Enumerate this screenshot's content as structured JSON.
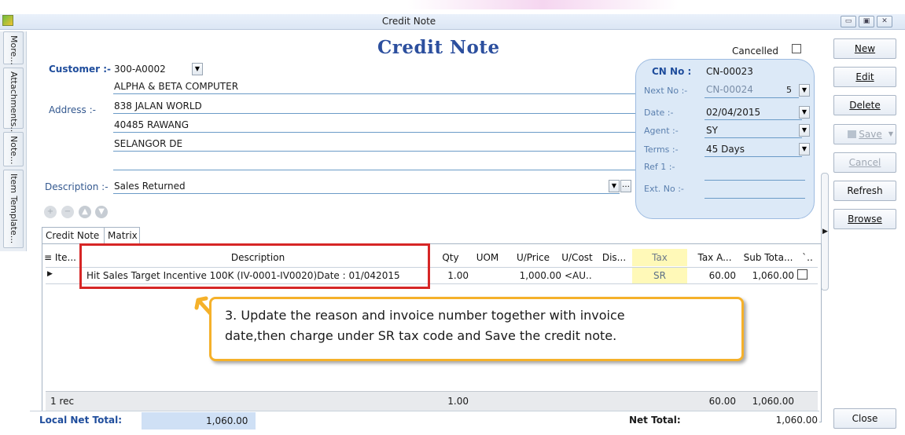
{
  "window": {
    "title": "Credit Note",
    "controls": [
      "minimize",
      "restore",
      "close"
    ]
  },
  "left_tabs": [
    "More...",
    "Attachments...",
    "Note...",
    "Item Template..."
  ],
  "heading": "Credit Note",
  "customer": {
    "label": "Customer :-",
    "code": "300-A0002",
    "name": "ALPHA & BETA COMPUTER",
    "address_label": "Address :-",
    "address_lines": [
      "838 JALAN WORLD",
      "40485 RAWANG",
      "SELANGOR DE",
      ""
    ]
  },
  "description": {
    "label": "Description :-",
    "value": "Sales Returned"
  },
  "cancelled": {
    "label": "Cancelled",
    "checked": false
  },
  "cn_panel": {
    "cn_no_label": "CN No :",
    "cn_no": "CN-00023",
    "next_no_label": "Next No :-",
    "next_no": "CN-00024",
    "next_no_suffix": "5",
    "date_label": "Date :-",
    "date": "02/04/2015",
    "agent_label": "Agent :-",
    "agent": "SY",
    "terms_label": "Terms :-",
    "terms": "45 Days",
    "ref1_label": "Ref 1 :-",
    "ref1": "",
    "ext_no_label": "Ext. No :-",
    "ext_no": ""
  },
  "right_buttons": {
    "new": "New",
    "edit": "Edit",
    "delete": "Delete",
    "save": "Save",
    "cancel": "Cancel",
    "refresh": "Refresh",
    "browse": "Browse",
    "close": "Close"
  },
  "tabs": [
    "Credit Note",
    "Matrix"
  ],
  "grid": {
    "columns": [
      "Ite...",
      "Description",
      "Qty",
      "UOM",
      "U/Price",
      "U/Cost",
      "Dis...",
      "Tax",
      "Tax A...",
      "Sub Tota...",
      "`.."
    ],
    "rows": [
      {
        "item": "",
        "description": "Hit Sales Target Incentive 100K (IV-0001-IV0020)Date : 01/042015",
        "qty": "1.00",
        "uom": "",
        "uprice": "1,000.00",
        "ucost": "<AU..",
        "disc": "",
        "tax": "SR",
        "tax_amount": "60.00",
        "subtotal": "1,060.00"
      }
    ],
    "footer": {
      "records": "1 rec",
      "qty_total": "1.00",
      "tax_total": "60.00",
      "sub_total": "1,060.00"
    }
  },
  "callout": {
    "line1": "3. Update the reason and invoice number together with invoice",
    "line2": "date,then charge under SR tax code and Save the credit note."
  },
  "totals": {
    "local_net_total_label": "Local Net Total:",
    "local_net_total": "1,060.00",
    "net_total_label": "Net Total:",
    "net_total": "1,060.00"
  },
  "colors": {
    "heading": "#2c4f9e",
    "panel_bg": "#dce9f7",
    "tax_highlight": "#fff9b8",
    "annotation_red": "#d62626",
    "callout_orange": "#f5b12a"
  }
}
